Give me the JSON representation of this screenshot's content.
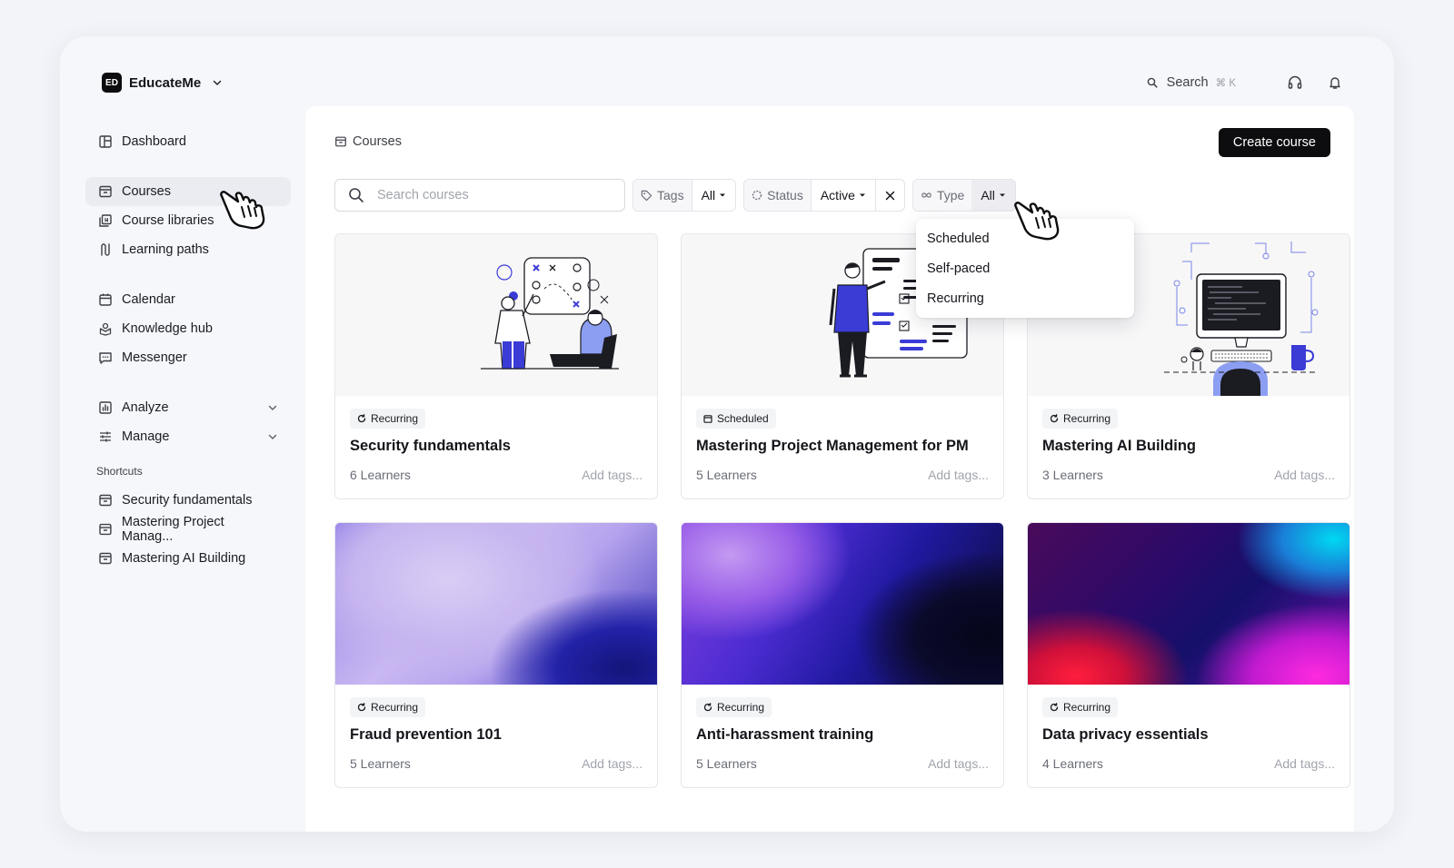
{
  "brand": {
    "logo": "ED",
    "name": "EducateMe"
  },
  "topbar": {
    "search_label": "Search",
    "search_shortcut": "⌘ K"
  },
  "sidebar": {
    "group1": [
      {
        "label": "Dashboard",
        "icon": "dashboard-icon"
      }
    ],
    "group2": [
      {
        "label": "Courses",
        "icon": "courses-icon",
        "active": true
      },
      {
        "label": "Course libraries",
        "icon": "library-icon"
      },
      {
        "label": "Learning paths",
        "icon": "path-icon"
      }
    ],
    "group3": [
      {
        "label": "Calendar",
        "icon": "calendar-icon"
      },
      {
        "label": "Knowledge hub",
        "icon": "knowledge-icon"
      },
      {
        "label": "Messenger",
        "icon": "messenger-icon"
      }
    ],
    "group4": [
      {
        "label": "Analyze",
        "icon": "analyze-icon"
      },
      {
        "label": "Manage",
        "icon": "manage-icon"
      }
    ],
    "shortcuts_label": "Shortcuts",
    "shortcuts": [
      {
        "label": "Security fundamentals"
      },
      {
        "label": "Mastering Project Manag..."
      },
      {
        "label": "Mastering AI Building"
      }
    ]
  },
  "main": {
    "breadcrumb": "Courses",
    "create_button": "Create course",
    "search_placeholder": "Search courses",
    "filters": {
      "tags_label": "Tags",
      "tags_value": "All",
      "status_label": "Status",
      "status_value": "Active",
      "type_label": "Type",
      "type_value": "All"
    },
    "type_options": [
      "Scheduled",
      "Self-paced",
      "Recurring"
    ],
    "courses": [
      {
        "type": "Recurring",
        "title": "Security fundamentals",
        "learners": "6 Learners",
        "tags": "Add tags..."
      },
      {
        "type": "Scheduled",
        "title": "Mastering Project Management for PM",
        "learners": "5 Learners",
        "tags": "Add tags..."
      },
      {
        "type": "Recurring",
        "title": "Mastering AI Building",
        "learners": "3 Learners",
        "tags": "Add tags..."
      },
      {
        "type": "Recurring",
        "title": "Fraud prevention 101",
        "learners": "5 Learners",
        "tags": "Add tags..."
      },
      {
        "type": "Recurring",
        "title": "Anti-harassment training",
        "learners": "5 Learners",
        "tags": "Add tags..."
      },
      {
        "type": "Recurring",
        "title": "Data privacy essentials",
        "learners": "4 Learners",
        "tags": "Add tags..."
      }
    ]
  },
  "colors": {
    "accent": "#3b3bd6",
    "dark": "#0d0d0f"
  }
}
